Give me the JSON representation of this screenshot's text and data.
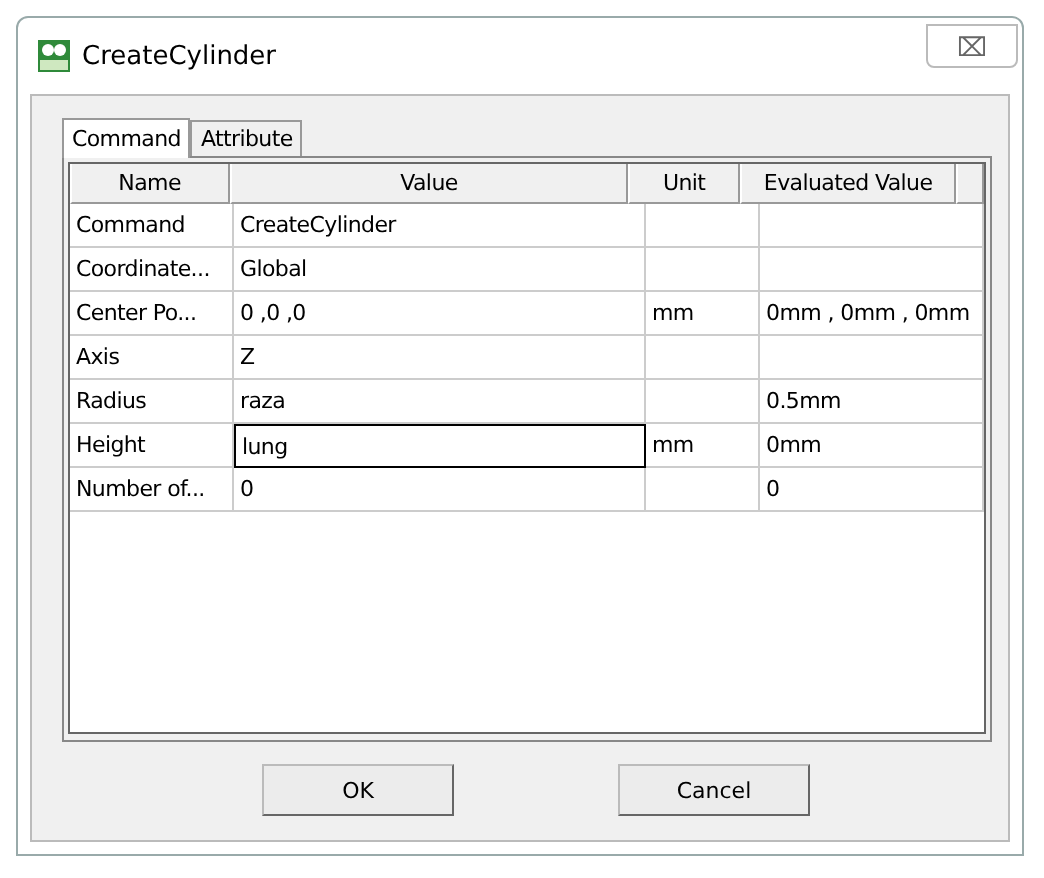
{
  "window": {
    "title": "CreateCylinder",
    "close": "⌧"
  },
  "tabs": [
    {
      "label": "Command",
      "selected": true
    },
    {
      "label": "Attribute",
      "selected": false
    }
  ],
  "table": {
    "columns": [
      "Name",
      "Value",
      "Unit",
      "Evaluated Value"
    ],
    "rows": [
      {
        "name": "Command",
        "value": "CreateCylinder",
        "unit": "",
        "evaluated": "",
        "editing": false
      },
      {
        "name": "Coordinate...",
        "value": "Global",
        "unit": "",
        "evaluated": "",
        "editing": false
      },
      {
        "name": "Center Po...",
        "value": "0 ,0 ,0",
        "unit": "mm",
        "evaluated": "0mm , 0mm , 0mm",
        "editing": false
      },
      {
        "name": "Axis",
        "value": "Z",
        "unit": "",
        "evaluated": "",
        "editing": false
      },
      {
        "name": "Radius",
        "value": "raza",
        "unit": "",
        "evaluated": "0.5mm",
        "editing": false
      },
      {
        "name": "Height",
        "value": "lung",
        "unit": "mm",
        "evaluated": "0mm",
        "editing": true
      },
      {
        "name": "Number of...",
        "value": "0",
        "unit": "",
        "evaluated": "0",
        "editing": false
      }
    ]
  },
  "buttons": [
    "OK",
    "Cancel"
  ]
}
